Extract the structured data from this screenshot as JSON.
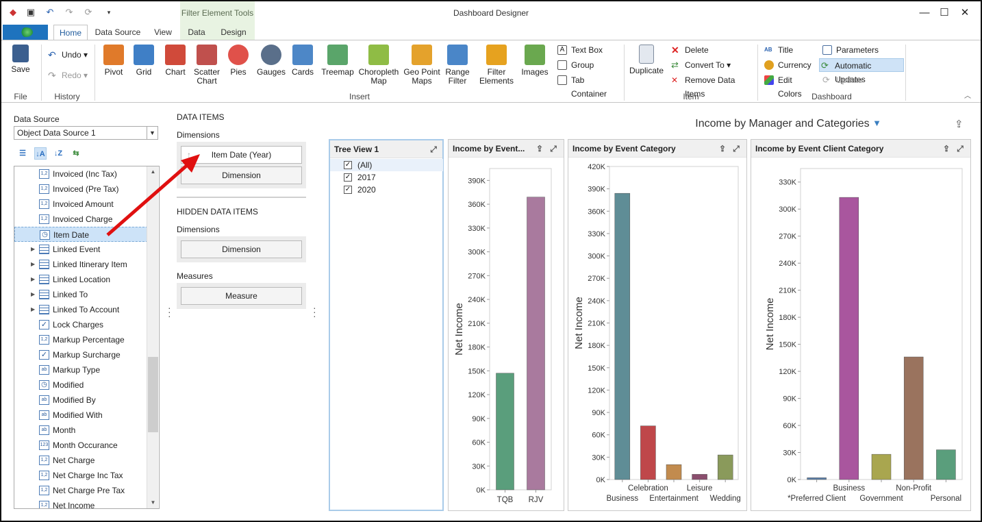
{
  "app": {
    "title": "Dashboard Designer",
    "context_tab_group": "Filter Element Tools"
  },
  "tabs": [
    "Home",
    "Data Source",
    "View",
    "Data",
    "Design"
  ],
  "ribbon": {
    "file": {
      "save": "Save",
      "group": "File"
    },
    "history": {
      "undo": "Undo",
      "redo": "Redo",
      "group": "History"
    },
    "insert": {
      "group": "Insert",
      "items": [
        {
          "label": "Pivot",
          "icon": "pivot-icon",
          "color": "#e07a2a"
        },
        {
          "label": "Grid",
          "icon": "grid-icon",
          "color": "#3f7fc6"
        },
        {
          "label": "Chart",
          "icon": "chart-icon",
          "color": "#d04a3a"
        },
        {
          "label": "Scatter\nChart",
          "icon": "scatter-chart-icon",
          "color": "#c0504d"
        },
        {
          "label": "Pies",
          "icon": "pie-icon",
          "color": "#e0514a"
        },
        {
          "label": "Gauges",
          "icon": "gauge-icon",
          "color": "#5a6f8a"
        },
        {
          "label": "Cards",
          "icon": "cards-icon",
          "color": "#4d87c7"
        },
        {
          "label": "Treemap",
          "icon": "treemap-icon",
          "color": "#5aa56a"
        },
        {
          "label": "Choropleth\nMap",
          "icon": "choropleth-map-icon",
          "color": "#8fbc45"
        },
        {
          "label": "Geo Point\nMaps",
          "icon": "geo-point-map-icon",
          "color": "#e4a22c"
        },
        {
          "label": "Range\nFilter",
          "icon": "range-filter-icon",
          "color": "#4a86c8"
        },
        {
          "label": "Filter\nElements",
          "icon": "filter-elements-icon",
          "color": "#e6a21f"
        },
        {
          "label": "Images",
          "icon": "images-icon",
          "color": "#6aa84f"
        }
      ],
      "small": [
        "Text Box",
        "Group",
        "Tab Container"
      ]
    },
    "item": {
      "group": "Item",
      "duplicate": "Duplicate",
      "delete": "Delete",
      "convert_to": "Convert To",
      "remove_data_items": "Remove Data Items"
    },
    "dashboard": {
      "group": "Dashboard",
      "title": "Title",
      "currency": "Currency",
      "edit_colors": "Edit Colors",
      "parameters": "Parameters",
      "automatic_updates": "Automatic Updates",
      "update": "Update"
    }
  },
  "datasource": {
    "label": "Data Source",
    "selected": "Object Data Source 1",
    "fields": [
      {
        "name": "Invoiced (Inc Tax)",
        "type": "1,2",
        "expandable": false
      },
      {
        "name": "Invoiced (Pre Tax)",
        "type": "1,2",
        "expandable": false
      },
      {
        "name": "Invoiced Amount",
        "type": "1,2",
        "expandable": false
      },
      {
        "name": "Invoiced Charge",
        "type": "1,2",
        "expandable": false
      },
      {
        "name": "Item Date",
        "type": "date",
        "expandable": false,
        "selected": true
      },
      {
        "name": "Linked Event",
        "type": "table",
        "expandable": true
      },
      {
        "name": "Linked Itinerary Item",
        "type": "table",
        "expandable": true
      },
      {
        "name": "Linked Location",
        "type": "table",
        "expandable": true
      },
      {
        "name": "Linked To",
        "type": "table",
        "expandable": true
      },
      {
        "name": "Linked To Account",
        "type": "table",
        "expandable": true
      },
      {
        "name": "Lock Charges",
        "type": "bool",
        "expandable": false
      },
      {
        "name": "Markup Percentage",
        "type": "1,2",
        "expandable": false
      },
      {
        "name": "Markup Surcharge",
        "type": "bool",
        "expandable": false
      },
      {
        "name": "Markup Type",
        "type": "ab",
        "expandable": false
      },
      {
        "name": "Modified",
        "type": "date",
        "expandable": false
      },
      {
        "name": "Modified By",
        "type": "ab",
        "expandable": false
      },
      {
        "name": "Modified With",
        "type": "ab",
        "expandable": false
      },
      {
        "name": "Month",
        "type": "ab",
        "expandable": false
      },
      {
        "name": "Month Occurance",
        "type": "123",
        "expandable": false
      },
      {
        "name": "Net Charge",
        "type": "1,2",
        "expandable": false
      },
      {
        "name": "Net Charge Inc Tax",
        "type": "1,2",
        "expandable": false
      },
      {
        "name": "Net Charge Pre Tax",
        "type": "1,2",
        "expandable": false
      },
      {
        "name": "Net Income",
        "type": "1,2",
        "expandable": false
      }
    ]
  },
  "data_items": {
    "header": "DATA ITEMS",
    "dimensions_label": "Dimensions",
    "dimension_item": "Item Date (Year)",
    "dimension_placeholder": "Dimension",
    "hidden_header": "HIDDEN DATA ITEMS",
    "hidden_dimensions_label": "Dimensions",
    "hidden_dimension_placeholder": "Dimension",
    "measures_label": "Measures",
    "measure_placeholder": "Measure"
  },
  "dashboard": {
    "title": "Income by Manager and Categories",
    "tree_view": {
      "title": "Tree View 1",
      "items": [
        "(All)",
        "2017",
        "2020"
      ]
    }
  },
  "chart_data": [
    {
      "type": "bar",
      "title": "Income by Event...",
      "ylabel": "Net Income",
      "categories": [
        "TQB",
        "RJV"
      ],
      "values": [
        147000,
        369000
      ],
      "colors": [
        "#5a9e7c",
        "#a97a9e"
      ],
      "yticks": [
        0,
        30000,
        60000,
        90000,
        120000,
        150000,
        180000,
        210000,
        240000,
        270000,
        300000,
        330000,
        360000,
        390000
      ],
      "ytick_labels": [
        "0K",
        "30K",
        "60K",
        "90K",
        "120K",
        "150K",
        "180K",
        "210K",
        "240K",
        "270K",
        "300K",
        "330K",
        "360K",
        "390K"
      ],
      "ylim": [
        0,
        405000
      ]
    },
    {
      "type": "bar",
      "title": "Income by Event Category",
      "ylabel": "Net Income",
      "categories": [
        "Business",
        "Celebration",
        "Entertainment",
        "Leisure",
        "Wedding"
      ],
      "values": [
        384000,
        72000,
        20000,
        7000,
        33000
      ],
      "colors": [
        "#5f8d96",
        "#bf474a",
        "#c28b4e",
        "#8b4e6e",
        "#8a9a5b"
      ],
      "yticks": [
        0,
        30000,
        60000,
        90000,
        120000,
        150000,
        180000,
        210000,
        240000,
        270000,
        300000,
        330000,
        360000,
        390000,
        420000
      ],
      "ytick_labels": [
        "0K",
        "30K",
        "60K",
        "90K",
        "120K",
        "150K",
        "180K",
        "210K",
        "240K",
        "270K",
        "300K",
        "330K",
        "360K",
        "390K",
        "420K"
      ],
      "ylim": [
        0,
        420000
      ]
    },
    {
      "type": "bar",
      "title": "Income by Event Client Category",
      "ylabel": "Net Income",
      "categories": [
        "*Preferred Client",
        "Business",
        "Government",
        "Non-Profit",
        "Personal"
      ],
      "values": [
        2000,
        313000,
        28000,
        136000,
        33000
      ],
      "colors": [
        "#5b7fa8",
        "#a9569e",
        "#a9a64f",
        "#9a735e",
        "#5a9e7c"
      ],
      "yticks": [
        0,
        30000,
        60000,
        90000,
        120000,
        150000,
        180000,
        210000,
        240000,
        270000,
        300000,
        330000
      ],
      "ytick_labels": [
        "0K",
        "30K",
        "60K",
        "90K",
        "120K",
        "150K",
        "180K",
        "210K",
        "240K",
        "270K",
        "300K",
        "330K"
      ],
      "ylim": [
        0,
        345000
      ]
    }
  ]
}
